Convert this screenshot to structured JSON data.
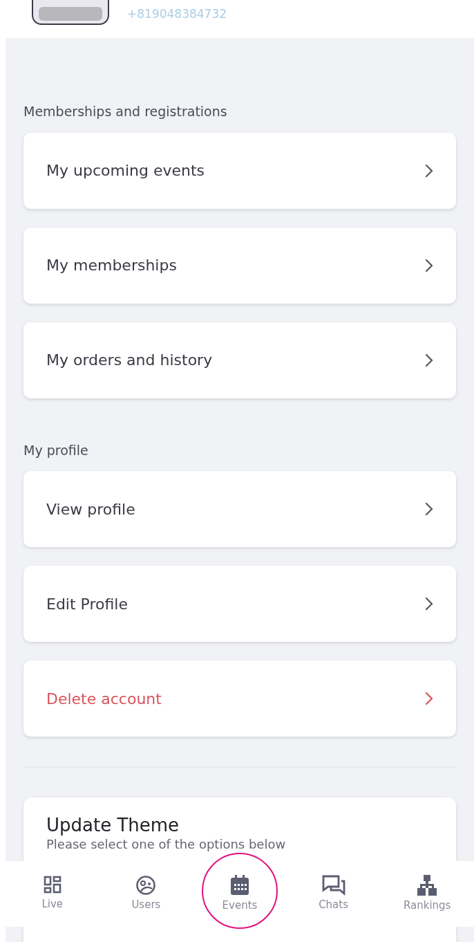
{
  "header": {
    "phone": "+819048384732"
  },
  "sections": [
    {
      "title": "Memberships and registrations",
      "items": [
        {
          "label": "My upcoming events",
          "kind": "normal"
        },
        {
          "label": "My memberships",
          "kind": "normal"
        },
        {
          "label": "My orders and history",
          "kind": "normal"
        }
      ]
    },
    {
      "title": "My profile",
      "items": [
        {
          "label": "View profile",
          "kind": "normal"
        },
        {
          "label": "Edit Profile",
          "kind": "normal"
        },
        {
          "label": "Delete account",
          "kind": "danger"
        }
      ]
    }
  ],
  "theme_card": {
    "title": "Update Theme",
    "subtitle": "Please select one of the options below"
  },
  "bottom_nav": [
    {
      "label": "Live",
      "highlighted": false
    },
    {
      "label": "Users",
      "highlighted": false
    },
    {
      "label": "Events",
      "highlighted": true
    },
    {
      "label": "Chats",
      "highlighted": false
    },
    {
      "label": "Rankings",
      "highlighted": false
    }
  ]
}
